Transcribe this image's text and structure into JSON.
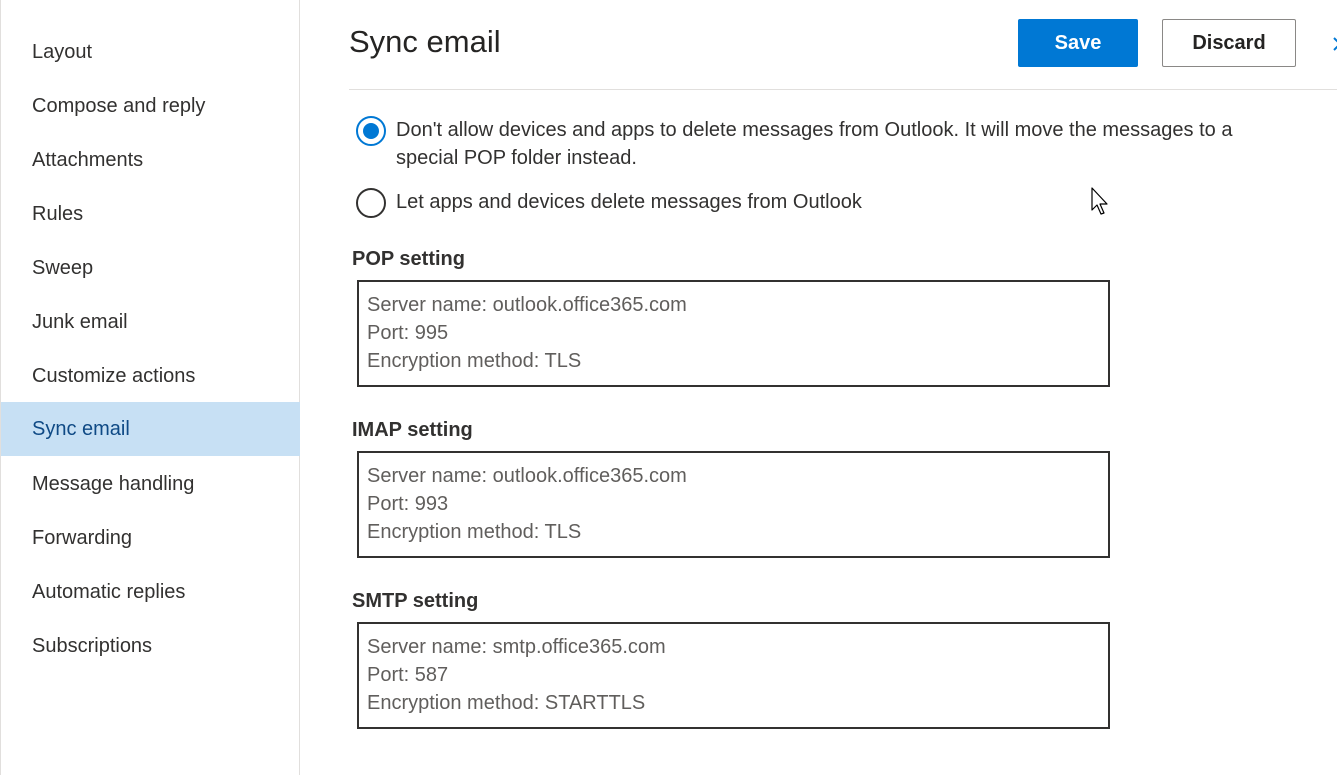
{
  "sidebar": {
    "items": [
      {
        "label": "Layout"
      },
      {
        "label": "Compose and reply"
      },
      {
        "label": "Attachments"
      },
      {
        "label": "Rules"
      },
      {
        "label": "Sweep"
      },
      {
        "label": "Junk email"
      },
      {
        "label": "Customize actions"
      },
      {
        "label": "Sync email",
        "active": true
      },
      {
        "label": "Message handling"
      },
      {
        "label": "Forwarding"
      },
      {
        "label": "Automatic replies"
      },
      {
        "label": "Subscriptions"
      }
    ]
  },
  "header": {
    "title": "Sync email",
    "save_label": "Save",
    "discard_label": "Discard"
  },
  "pop_delete": {
    "options": [
      {
        "label": "Don't allow devices and apps to delete messages from Outlook. It will move the messages to a special POP folder instead.",
        "checked": true
      },
      {
        "label": "Let apps and devices delete messages from Outlook",
        "checked": false
      }
    ]
  },
  "settings": {
    "pop": {
      "title": "POP setting",
      "server": "Server name: outlook.office365.com",
      "port": "Port: 995",
      "encryption": "Encryption method: TLS"
    },
    "imap": {
      "title": "IMAP setting",
      "server": "Server name: outlook.office365.com",
      "port": "Port: 993",
      "encryption": "Encryption method: TLS"
    },
    "smtp": {
      "title": "SMTP setting",
      "server": "Server name: smtp.office365.com",
      "port": "Port: 587",
      "encryption": "Encryption method: STARTTLS"
    }
  },
  "colors": {
    "accent": "#0078d4",
    "nav_active_bg": "#c7e0f4",
    "nav_active_text": "#0f4a85"
  }
}
